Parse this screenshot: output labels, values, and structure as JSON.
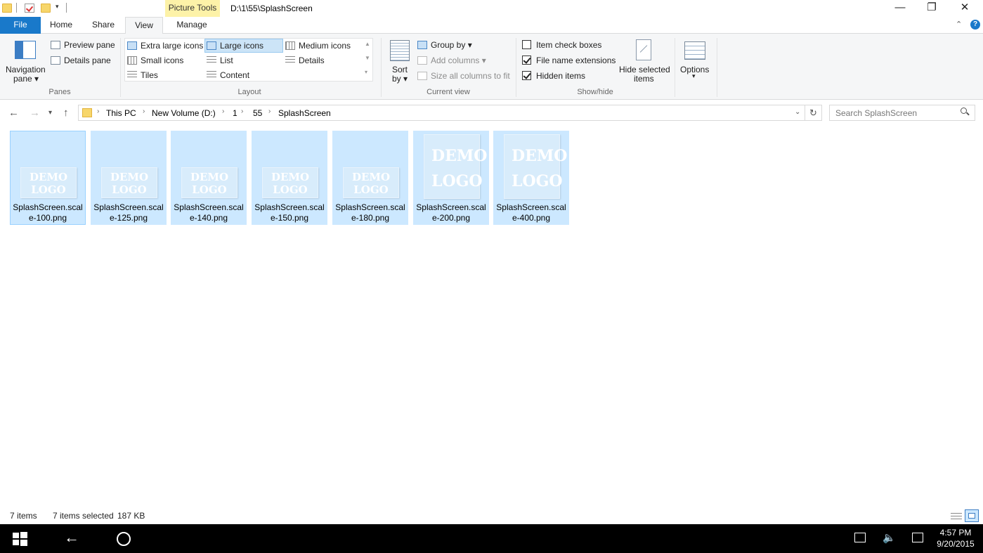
{
  "window": {
    "title": "D:\\1\\55\\SplashScreen",
    "context_tab": "Picture Tools",
    "controls": {
      "minimize": "—",
      "restore": "❐",
      "close": "✕"
    }
  },
  "tabs": {
    "file": "File",
    "home": "Home",
    "share": "Share",
    "view": "View",
    "manage": "Manage"
  },
  "ribbon": {
    "panes": {
      "navigation_pane": "Navigation",
      "navigation_pane_2": "pane",
      "preview_pane": "Preview pane",
      "details_pane": "Details pane",
      "label": "Panes"
    },
    "layout": {
      "extra_large_icons": "Extra large icons",
      "large_icons": "Large icons",
      "medium_icons": "Medium icons",
      "small_icons": "Small icons",
      "list": "List",
      "details": "Details",
      "tiles": "Tiles",
      "content": "Content",
      "label": "Layout",
      "selected": "Large icons"
    },
    "current_view": {
      "sort_by": "Sort",
      "sort_by_2": "by",
      "group_by": "Group by",
      "add_columns": "Add columns",
      "size_all_columns": "Size all columns to fit",
      "label": "Current view"
    },
    "show_hide": {
      "item_check_boxes": "Item check boxes",
      "item_check_boxes_checked": false,
      "file_name_extensions": "File name extensions",
      "file_name_extensions_checked": true,
      "hidden_items": "Hidden items",
      "hidden_items_checked": true,
      "hide_selected_items": "Hide selected",
      "hide_selected_items_2": "items",
      "label": "Show/hide"
    },
    "options": "Options"
  },
  "address": {
    "crumbs": [
      "This PC",
      "New Volume (D:)",
      "1",
      "55",
      "SplashScreen"
    ],
    "search_placeholder": "Search SplashScreen"
  },
  "files": [
    {
      "line1": "SplashScreen.scal",
      "line2": "e-100.png",
      "thumb": "DEMO LOGO"
    },
    {
      "line1": "SplashScreen.scal",
      "line2": "e-125.png",
      "thumb": "DEMO LOGO"
    },
    {
      "line1": "SplashScreen.scal",
      "line2": "e-140.png",
      "thumb": "DEMO LOGO"
    },
    {
      "line1": "SplashScreen.scal",
      "line2": "e-150.png",
      "thumb": "DEMO LOGO"
    },
    {
      "line1": "SplashScreen.scal",
      "line2": "e-180.png",
      "thumb": "DEMO LOGO"
    },
    {
      "line1": "SplashScreen.scal",
      "line2": "e-200.png",
      "thumb": "DEMO LOGO"
    },
    {
      "line1": "SplashScreen.scal",
      "line2": "e-400.png",
      "thumb": "DEMO LOGO"
    }
  ],
  "status": {
    "count": "7 items",
    "selected": "7 items selected",
    "size": "187 KB"
  },
  "taskbar": {
    "time": "4:57 PM",
    "date": "9/20/2015"
  },
  "colors": {
    "accent": "#1979ca",
    "selection": "#cce8ff",
    "picture_tools": "#fdf2a8"
  }
}
